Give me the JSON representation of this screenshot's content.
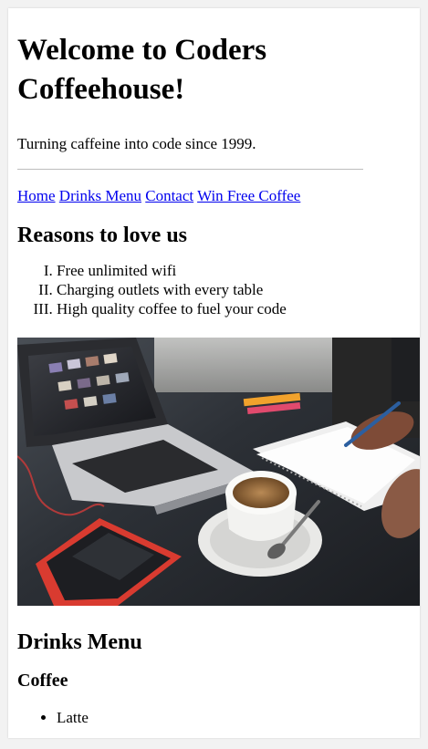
{
  "header": {
    "title": "Welcome to Coders Coffeehouse!",
    "tagline": "Turning caffeine into code since 1999."
  },
  "nav": {
    "links": [
      {
        "label": "Home"
      },
      {
        "label": "Drinks Menu"
      },
      {
        "label": "Contact"
      },
      {
        "label": "Win Free Coffee"
      }
    ]
  },
  "reasons": {
    "heading": "Reasons to love us",
    "items": [
      "Free unlimited wifi",
      "Charging outlets with every table",
      "High quality coffee to fuel your code"
    ]
  },
  "hero_image": {
    "subject": "laptop, smartphone, cup of coffee and notebook on a dark desk"
  },
  "menu": {
    "heading": "Drinks Menu",
    "coffee_heading": "Coffee",
    "coffee_items": [
      "Latte"
    ]
  },
  "colors": {
    "link": "#0000ee",
    "page_background": "#ffffff",
    "frame_background": "#f2f2f2"
  }
}
